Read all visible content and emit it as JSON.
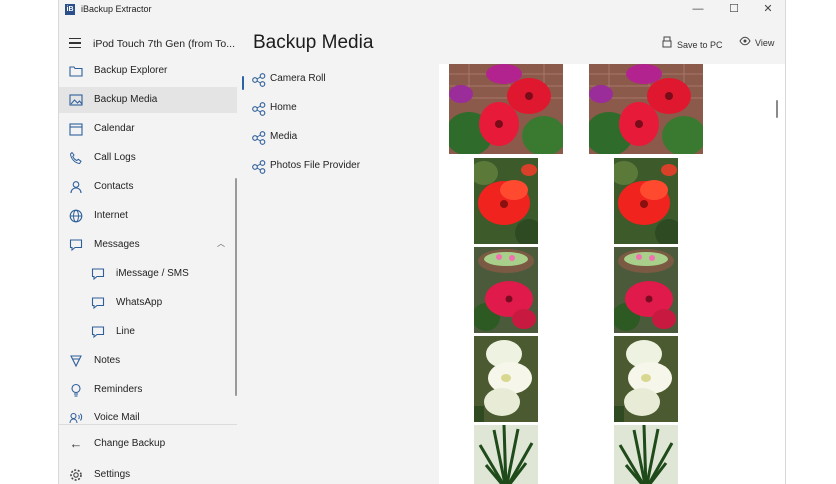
{
  "app": {
    "title": "iBackup Extractor",
    "icon_text": "iB"
  },
  "window_controls": {
    "minimize": "—",
    "maximize": "☐",
    "close": "✕"
  },
  "sidebar": {
    "device": "iPod Touch 7th Gen (from To...",
    "items": [
      {
        "label": "Backup Explorer",
        "icon": "folder-icon"
      },
      {
        "label": "Backup Media",
        "icon": "image-icon"
      },
      {
        "label": "Calendar",
        "icon": "calendar-icon"
      },
      {
        "label": "Call Logs",
        "icon": "phone-icon"
      },
      {
        "label": "Contacts",
        "icon": "person-icon"
      },
      {
        "label": "Internet",
        "icon": "globe-icon"
      },
      {
        "label": "Messages",
        "icon": "chat-icon"
      },
      {
        "label": "iMessage / SMS",
        "icon": "chat-icon"
      },
      {
        "label": "WhatsApp",
        "icon": "chat-icon"
      },
      {
        "label": "Line",
        "icon": "chat-icon"
      },
      {
        "label": "Notes",
        "icon": "notes-icon"
      },
      {
        "label": "Reminders",
        "icon": "bulb-icon"
      },
      {
        "label": "Voice Mail",
        "icon": "voicemail-icon"
      }
    ],
    "change_backup": "Change Backup",
    "settings": "Settings"
  },
  "main": {
    "title": "Backup Media",
    "toolbar": {
      "save": "Save to PC",
      "view": "View"
    },
    "folders": [
      "Camera Roll",
      "Home",
      "Media",
      "Photos File Provider"
    ]
  },
  "colors": {
    "accent": "#2c63a8",
    "icon": "#2f5f9a"
  }
}
